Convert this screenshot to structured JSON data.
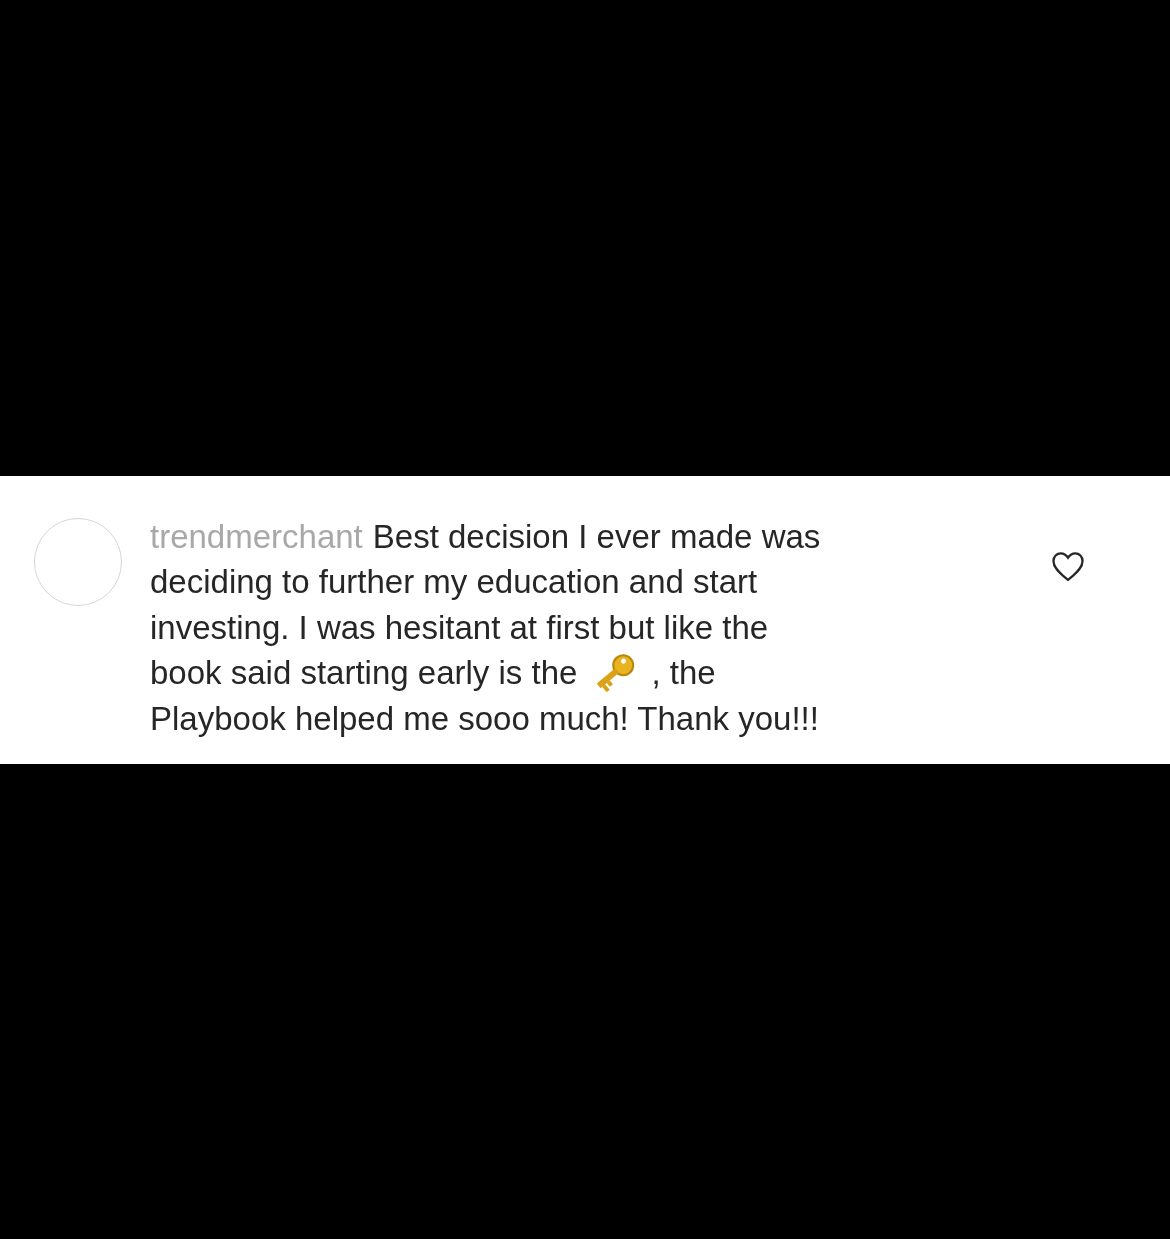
{
  "comment": {
    "username": "trendmerchant",
    "lines": [
      {
        "kind": "text",
        "parts": [
          "Best decision I ever made was"
        ]
      },
      {
        "kind": "text",
        "parts": [
          "deciding to further my education and start"
        ]
      },
      {
        "kind": "text",
        "parts": [
          "investing. I was hesitant at first but like the"
        ]
      },
      {
        "kind": "key",
        "parts": [
          "book said starting early is the",
          ", the"
        ]
      },
      {
        "kind": "text",
        "parts": [
          "Playbook helped me sooo much! Thank you!!!"
        ]
      }
    ],
    "liked": false
  }
}
